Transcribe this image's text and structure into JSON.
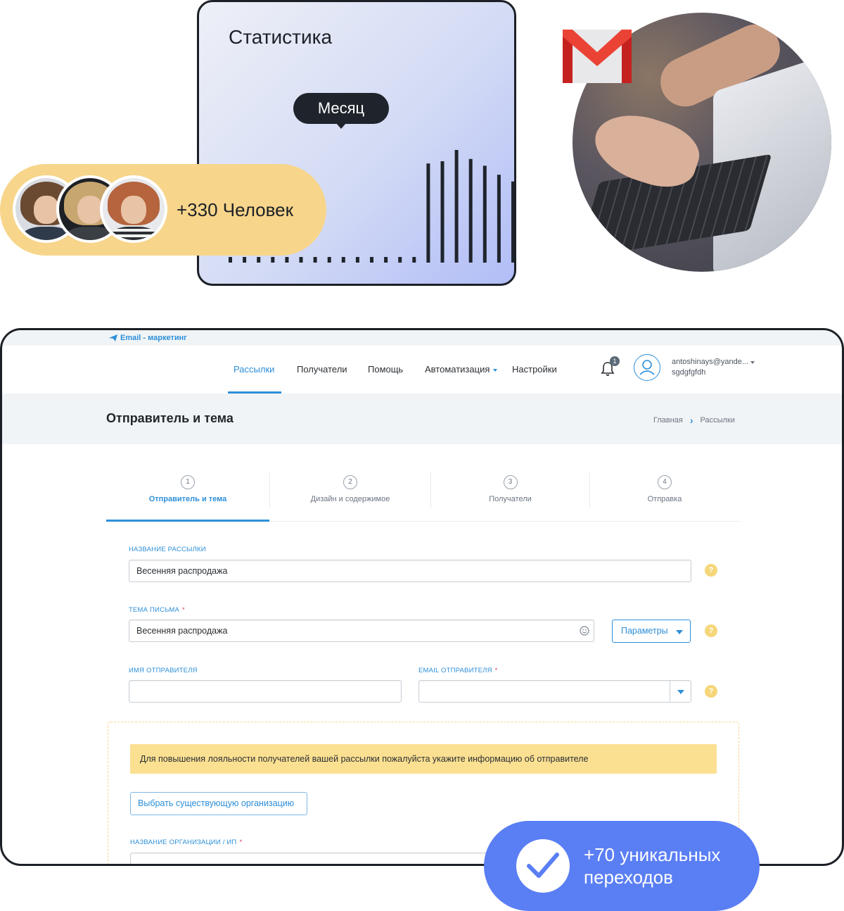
{
  "stats_card": {
    "title": "Статистика",
    "tooltip": "Месяц",
    "bar_levels": [
      0.05,
      0.05,
      0.05,
      0.05,
      0.05,
      0.05,
      0.05,
      0.05,
      0.05,
      0.05,
      0.05,
      0.05,
      0.05,
      0.05,
      0.88,
      0.9,
      1.0,
      0.92,
      0.86,
      0.78,
      0.72,
      0.86,
      0.82,
      0.72,
      0.65,
      0.78
    ]
  },
  "people_pill": {
    "label": "+330 Человек",
    "color": "#f7d58b"
  },
  "app": {
    "brand": "Email - маркетинг",
    "nav": [
      {
        "label": "Рассылки",
        "active": true
      },
      {
        "label": "Получатели",
        "active": false
      },
      {
        "label": "Помощь",
        "active": false
      },
      {
        "label": "Автоматизация",
        "active": false
      },
      {
        "label": "Настройки",
        "active": false
      }
    ],
    "notifications_count": "1",
    "user": {
      "email": "antoshinays@yande...",
      "name": "sgdgfgfdh"
    },
    "page_title": "Отправитель и тема",
    "breadcrumb": {
      "home": "Главная",
      "current": "Рассылки"
    },
    "steps": [
      {
        "num": "1",
        "label": "Отправитель и тема",
        "active": true
      },
      {
        "num": "2",
        "label": "Дизайн и содержимое",
        "active": false
      },
      {
        "num": "3",
        "label": "Получатели",
        "active": false
      },
      {
        "num": "4",
        "label": "Отправка",
        "active": false
      }
    ],
    "form": {
      "campaign_name_label": "НАЗВАНИЕ РАССЫЛКИ",
      "campaign_name_value": "Весенняя распродажа",
      "subject_label": "ТЕМА ПИСЬМА",
      "subject_value": "Весенняя распродажа",
      "params_button": "Параметры",
      "sender_name_label": "ИМЯ ОТПРАВИТЕЛЯ",
      "sender_name_value": "",
      "sender_email_label": "EMAIL ОТПРАВИТЕЛЯ",
      "sender_email_value": "",
      "required_mark": "*",
      "help_mark": "?",
      "notice": "Для повышения лояльности получателей вашей рассылки пожалуйста укажите информацию об отправителе",
      "choose_org_button": "Выбрать существующую организацию",
      "org_name_label": "НАЗВАНИЕ ОРГАНИЗАЦИИ / ИП"
    },
    "accent_color": "#2d8fd9"
  },
  "transitions_pill": {
    "line1": "+70 уникальных",
    "line2": "переходов",
    "color": "#5a7ef4"
  }
}
